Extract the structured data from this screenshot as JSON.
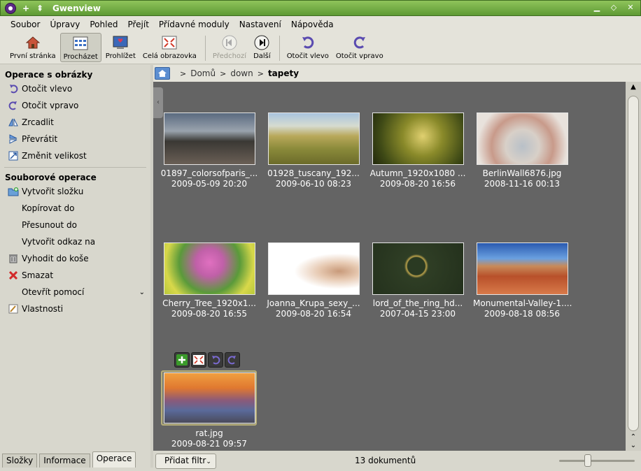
{
  "window": {
    "title": "Gwenview"
  },
  "menu": [
    "Soubor",
    "Úpravy",
    "Pohled",
    "Přejít",
    "Přídavné moduly",
    "Nastavení",
    "Nápověda"
  ],
  "toolbar": {
    "home": "První stránka",
    "browse": "Procházet",
    "view": "Prohlížet",
    "fullscreen": "Celá obrazovka",
    "previous": "Předchozí",
    "next": "Další",
    "rotate_left": "Otočit vlevo",
    "rotate_right": "Otočit vpravo"
  },
  "sidebar": {
    "image_ops_title": "Operace s obrázky",
    "image_ops": [
      "Otočit vlevo",
      "Otočit vpravo",
      "Zrcadlit",
      "Převrátit",
      "Změnit velikost"
    ],
    "file_ops_title": "Souborové operace",
    "file_ops": [
      "Vytvořit složku",
      "Kopírovat do",
      "Přesunout do",
      "Vytvořit odkaz na",
      "Vyhodit do koše",
      "Smazat",
      "Otevřít pomocí",
      "Vlastnosti"
    ],
    "tabs": [
      "Složky",
      "Informace",
      "Operace"
    ]
  },
  "breadcrumb": {
    "items": [
      "Domů",
      "down"
    ],
    "current": "tapety"
  },
  "thumbnails": [
    {
      "name": "01897_colorsofparis_...",
      "date": "2009-05-09 20:20"
    },
    {
      "name": "01928_tuscany_192...",
      "date": "2009-06-10 08:23"
    },
    {
      "name": "Autumn_1920x1080 ...",
      "date": "2009-08-20 16:56"
    },
    {
      "name": "BerlinWall6876.jpg",
      "date": "2008-11-16 00:13"
    },
    {
      "name": "Cherry_Tree_1920x1...",
      "date": "2009-08-20 16:55"
    },
    {
      "name": "Joanna_Krupa_sexy_...",
      "date": "2009-08-20 16:54"
    },
    {
      "name": "lord_of_the_ring_hd...",
      "date": "2007-04-15 23:00"
    },
    {
      "name": "Monumental-Valley-1....",
      "date": "2009-08-18 08:56"
    },
    {
      "name": "rat.jpg",
      "date": "2009-08-21 09:57"
    }
  ],
  "status": {
    "filter_button": "Přidat filtr",
    "count": "13 dokumentů"
  },
  "colors": {
    "titlebar": "#6fa944",
    "thumb_bg": "#646464",
    "panel": "#d8d7cd"
  }
}
